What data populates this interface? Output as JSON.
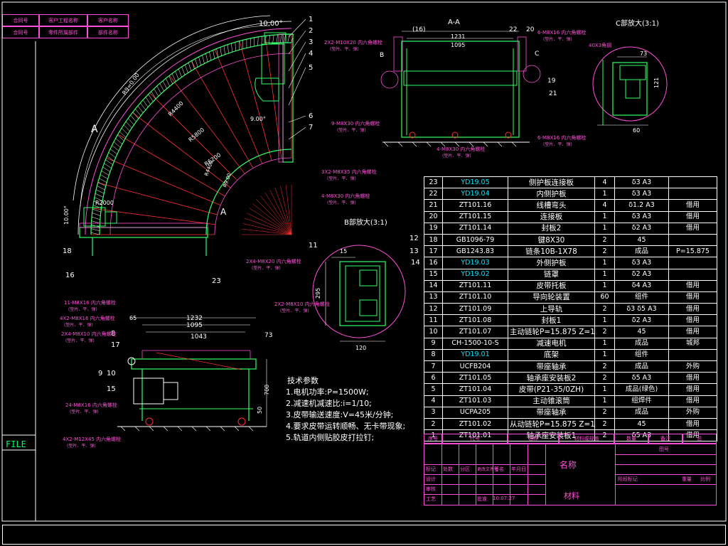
{
  "top_left_block": {
    "row1": [
      "合同号",
      "客户工程名称",
      "客户名称"
    ],
    "row2": [
      "合同号",
      "零件所属部件",
      "部件名称"
    ]
  },
  "file_label": "FILE",
  "views": {
    "main_arc": {
      "callouts_top": [
        "1",
        "2",
        "3",
        "4",
        "5",
        "6",
        "7"
      ],
      "callouts_left": [
        "18",
        "16",
        "23"
      ],
      "section_marks": [
        "A",
        "A"
      ],
      "dims": [
        "10.00°",
        "R9=0.00",
        "R4400",
        "R5800",
        "R6200",
        "9.00°",
        "R4400",
        "R9.00",
        "R2000",
        "10.00°"
      ],
      "notes": [
        "2X2-M10X20 内六角螺栓",
        "9-M8X30 内六角螺栓",
        "3X2-M8X35 内六角螺栓",
        "4-M8X30 内六角螺栓",
        "2X4-M8X20 内六角螺栓",
        "2X2-M8X10 内六角螺栓"
      ],
      "note_sub": "(垫片、平、弹)"
    },
    "section_aa": {
      "title": "A-A",
      "dims": [
        "1231",
        "1095"
      ],
      "callouts": [
        "(16)",
        "22",
        "20",
        "19",
        "21",
        "B",
        "C"
      ],
      "notes": [
        "6-M8X16 内六角螺栓",
        "4-M8X30 内六角螺栓",
        "6-M8X16 内六角螺栓"
      ],
      "note_sub": "(垫片、平、弹)"
    },
    "detail_c": {
      "title": "C部放大(3:1)",
      "dims": [
        "73",
        "60",
        "40X3角钢",
        "121"
      ]
    },
    "detail_b": {
      "title": "B部放大(3:1)",
      "callouts": [
        "11",
        "12",
        "13",
        "14"
      ],
      "dims": [
        "15",
        "120",
        "295"
      ]
    },
    "side_view": {
      "dims": [
        "1232",
        "1095",
        "1043",
        "73",
        "65",
        "700",
        "50"
      ],
      "callouts": [
        "8",
        "17",
        "9",
        "10",
        "15"
      ],
      "notes": [
        "11-M8X16 内六角螺栓",
        "4X2-M8X16 内六角螺栓",
        "2X4-M8X10 内六角螺栓",
        "24-M8X16 内六角螺栓",
        "4X2-M12X45 内六角螺栓"
      ],
      "note_sub": "(垫片、平、弹)"
    }
  },
  "tech_params": {
    "title": "技术参数",
    "lines": [
      "1.电机功率:P=1500W;",
      "2.减速机减速比:i=1/10;",
      "3.皮带输送速度:V=45米/分钟;",
      "4.要求皮带运转顺畅、无卡带现象;",
      "5.轨道内侧贴胶皮打拉钉;"
    ]
  },
  "bom": {
    "rows": [
      {
        "no": "23",
        "code": "YD19.05",
        "cyan": true,
        "name": "侧护板连接板",
        "qty": "4",
        "mat": "δ3 A3",
        "note": ""
      },
      {
        "no": "22",
        "code": "YD19.04",
        "cyan": true,
        "name": "内侧护板",
        "qty": "1",
        "mat": "δ3 A3",
        "note": ""
      },
      {
        "no": "21",
        "code": "ZT101.16",
        "cyan": false,
        "name": "线槽弯头",
        "qty": "4",
        "mat": "δ1.2 A3",
        "note": "借用"
      },
      {
        "no": "20",
        "code": "ZT101.15",
        "cyan": false,
        "name": "连接板",
        "qty": "1",
        "mat": "δ3 A3",
        "note": "借用"
      },
      {
        "no": "19",
        "code": "ZT101.14",
        "cyan": false,
        "name": "封板2",
        "qty": "1",
        "mat": "δ2 A3",
        "note": "借用"
      },
      {
        "no": "18",
        "code": "GB1096-79",
        "cyan": false,
        "name": "键8X30",
        "qty": "2",
        "mat": "45",
        "note": ""
      },
      {
        "no": "17",
        "code": "GB1243.83",
        "cyan": false,
        "name": "链条10B-1X78",
        "qty": "2",
        "mat": "成品",
        "note": "P=15.875"
      },
      {
        "no": "16",
        "code": "YD19.03",
        "cyan": true,
        "name": "外侧护板",
        "qty": "1",
        "mat": "δ3 A3",
        "note": ""
      },
      {
        "no": "15",
        "code": "YD19.02",
        "cyan": true,
        "name": "链罩",
        "qty": "1",
        "mat": "δ2 A3",
        "note": ""
      },
      {
        "no": "14",
        "code": "ZT101.11",
        "cyan": false,
        "name": "皮带托板",
        "qty": "1",
        "mat": "δ4 A3",
        "note": "借用"
      },
      {
        "no": "13",
        "code": "ZT101.10",
        "cyan": false,
        "name": "导向轮装置",
        "qty": "60",
        "mat": "组件",
        "note": "借用"
      },
      {
        "no": "12",
        "code": "ZT101.09",
        "cyan": false,
        "name": "上导轨",
        "qty": "2",
        "mat": "δ3 δ5 A3",
        "note": "借用"
      },
      {
        "no": "11",
        "code": "ZT101.08",
        "cyan": false,
        "name": "封板1",
        "qty": "1",
        "mat": "δ2 A3",
        "note": "借用"
      },
      {
        "no": "10",
        "code": "ZT101.07",
        "cyan": false,
        "name": "主动链轮P=15.875 Z=15",
        "qty": "2",
        "mat": "45",
        "note": "借用"
      },
      {
        "no": "9",
        "code": "CH-1500-10-S",
        "cyan": false,
        "name": "减速电机",
        "qty": "1",
        "mat": "成品",
        "note": "城邦"
      },
      {
        "no": "8",
        "code": "YD19.01",
        "cyan": true,
        "name": "底架",
        "qty": "1",
        "mat": "组件",
        "note": ""
      },
      {
        "no": "7",
        "code": "UCFB204",
        "cyan": false,
        "name": "带座轴承",
        "qty": "2",
        "mat": "成品",
        "note": "外购"
      },
      {
        "no": "6",
        "code": "ZT101.05",
        "cyan": false,
        "name": "轴承座安装板2",
        "qty": "2",
        "mat": "δ5 A3",
        "note": "借用"
      },
      {
        "no": "5",
        "code": "ZT101.04",
        "cyan": false,
        "name": "皮带(P21-35/0ZH)",
        "qty": "1",
        "mat": "成品(绿色)",
        "note": "借用"
      },
      {
        "no": "4",
        "code": "ZT101.03",
        "cyan": false,
        "name": "主动锥滚筒",
        "qty": "1",
        "mat": "组焊件",
        "note": "借用"
      },
      {
        "no": "3",
        "code": "UCPA205",
        "cyan": false,
        "name": "带座轴承",
        "qty": "2",
        "mat": "成品",
        "note": "外购"
      },
      {
        "no": "2",
        "code": "ZT101.02",
        "cyan": false,
        "name": "从动链轮P=15.875 Z=19",
        "qty": "2",
        "mat": "45",
        "note": "借用"
      },
      {
        "no": "1",
        "code": "ZT101.01",
        "cyan": false,
        "name": "轴承座安装板1",
        "qty": "2",
        "mat": "δ5 A3",
        "note": "借用"
      }
    ]
  },
  "title_block": {
    "header": [
      "序号",
      "代号",
      "名称",
      "材料或规格",
      "数量",
      "备注",
      "总"
    ],
    "name_label": "名称",
    "material_label": "材料",
    "drawing_no": "图号",
    "time": "10:07:27",
    "fields": [
      "标记",
      "处数",
      "分区",
      "更改文件号",
      "签名",
      "年月日",
      "设计",
      "审核",
      "工艺",
      "批准",
      "阶段标记",
      "重量",
      "比例"
    ]
  },
  "colors": {
    "background": "#000000",
    "frame": "#ffffff",
    "magenta": "#ff4fd8",
    "green": "#33ff66",
    "red": "#ff3030",
    "cyan": "#00e5ff",
    "yellow": "#ffff00"
  }
}
